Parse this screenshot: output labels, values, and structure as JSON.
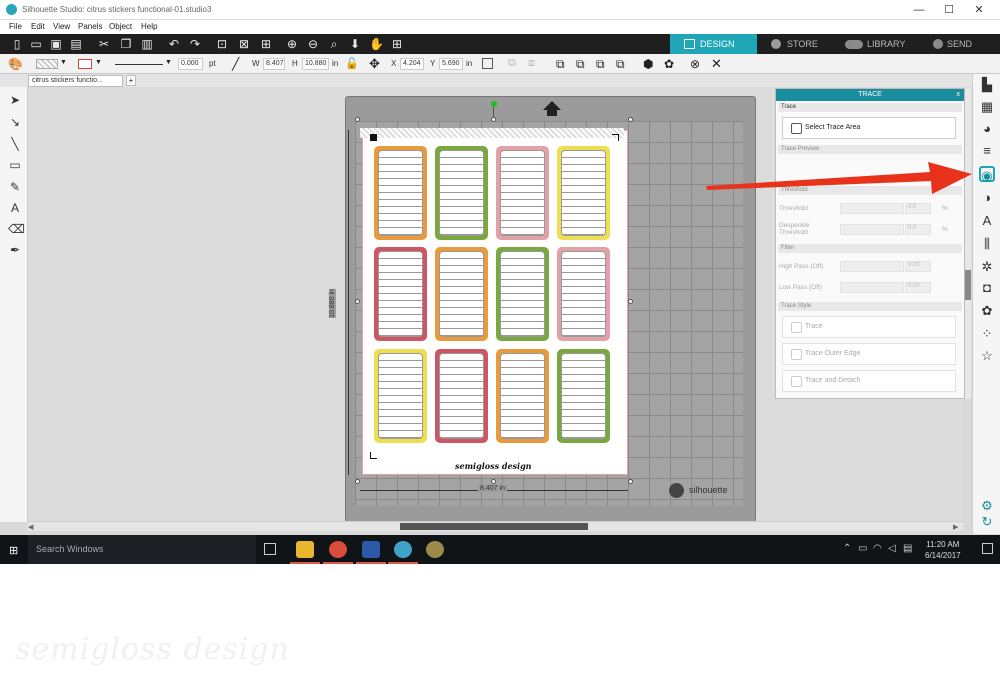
{
  "window": {
    "title": "Silhouette Studio: citrus stickers functional-01.studio3",
    "controls": [
      "—",
      "☐",
      "✕"
    ]
  },
  "menu": [
    "File",
    "Edit",
    "View",
    "Panels",
    "Object",
    "Help"
  ],
  "nav_tabs": [
    {
      "label": "DESIGN",
      "active": true
    },
    {
      "label": "STORE",
      "active": false
    },
    {
      "label": "LIBRARY",
      "active": false
    },
    {
      "label": "SEND",
      "active": false
    }
  ],
  "toolbar": {
    "line_width": "0.000",
    "line_unit": "pt",
    "w_label": "W",
    "w_value": "8.407",
    "h_label": "H",
    "h_value": "10.880",
    "h_unit": "in",
    "x_label": "X",
    "x_value": "4.204",
    "y_label": "Y",
    "y_value": "5.690",
    "xy_unit": "in"
  },
  "document_tab": {
    "name": "citrus stickers functio...",
    "add": "+"
  },
  "canvas": {
    "page_caption": "semigloss design",
    "width_dimension": "8.407 in",
    "height_dimension": "10.880 in",
    "mat_brand": "silhouette"
  },
  "stickers": [
    {
      "color": "#e99a3c"
    },
    {
      "color": "#79a83e"
    },
    {
      "color": "#e2a1a6"
    },
    {
      "color": "#ecdf52"
    },
    {
      "color": "#cd5662"
    },
    {
      "color": "#e99a3c"
    },
    {
      "color": "#79a83e"
    },
    {
      "color": "#e2a1a6"
    },
    {
      "color": "#ecdf52"
    },
    {
      "color": "#cd5662"
    },
    {
      "color": "#e99a3c"
    },
    {
      "color": "#79a83e"
    }
  ],
  "trace_panel": {
    "title": "TRACE",
    "close": "x",
    "section_trace": "Trace",
    "select_trace_area": "Select Trace Area",
    "section_trace_preview": "Trace Preview",
    "section_threshold": "Threshold",
    "threshold_label": "Threshold",
    "threshold_value": "0.0",
    "despeckle_label": "Despeckle Threshold",
    "despeckle_value": "0.0",
    "section_filter": "Filter",
    "high_pass_label": "High Pass (Off)",
    "high_pass_value": "0.00",
    "low_pass_label": "Low Pass (Off)",
    "low_pass_value": "0.00",
    "percent": "%",
    "section_trace_style": "Trace Style",
    "trace_btn": "Trace",
    "trace_outer_btn": "Trace Outer Edge",
    "trace_detach_btn": "Trace and Detach"
  },
  "taskbar": {
    "search": "Search Windows",
    "time": "11:20 AM",
    "date": "6/14/2017"
  },
  "watermark": "semigloss design",
  "colors": {
    "accent": "#1a8e9c",
    "arrow": "#e8321c",
    "design_tab": "#1fa7b8"
  }
}
